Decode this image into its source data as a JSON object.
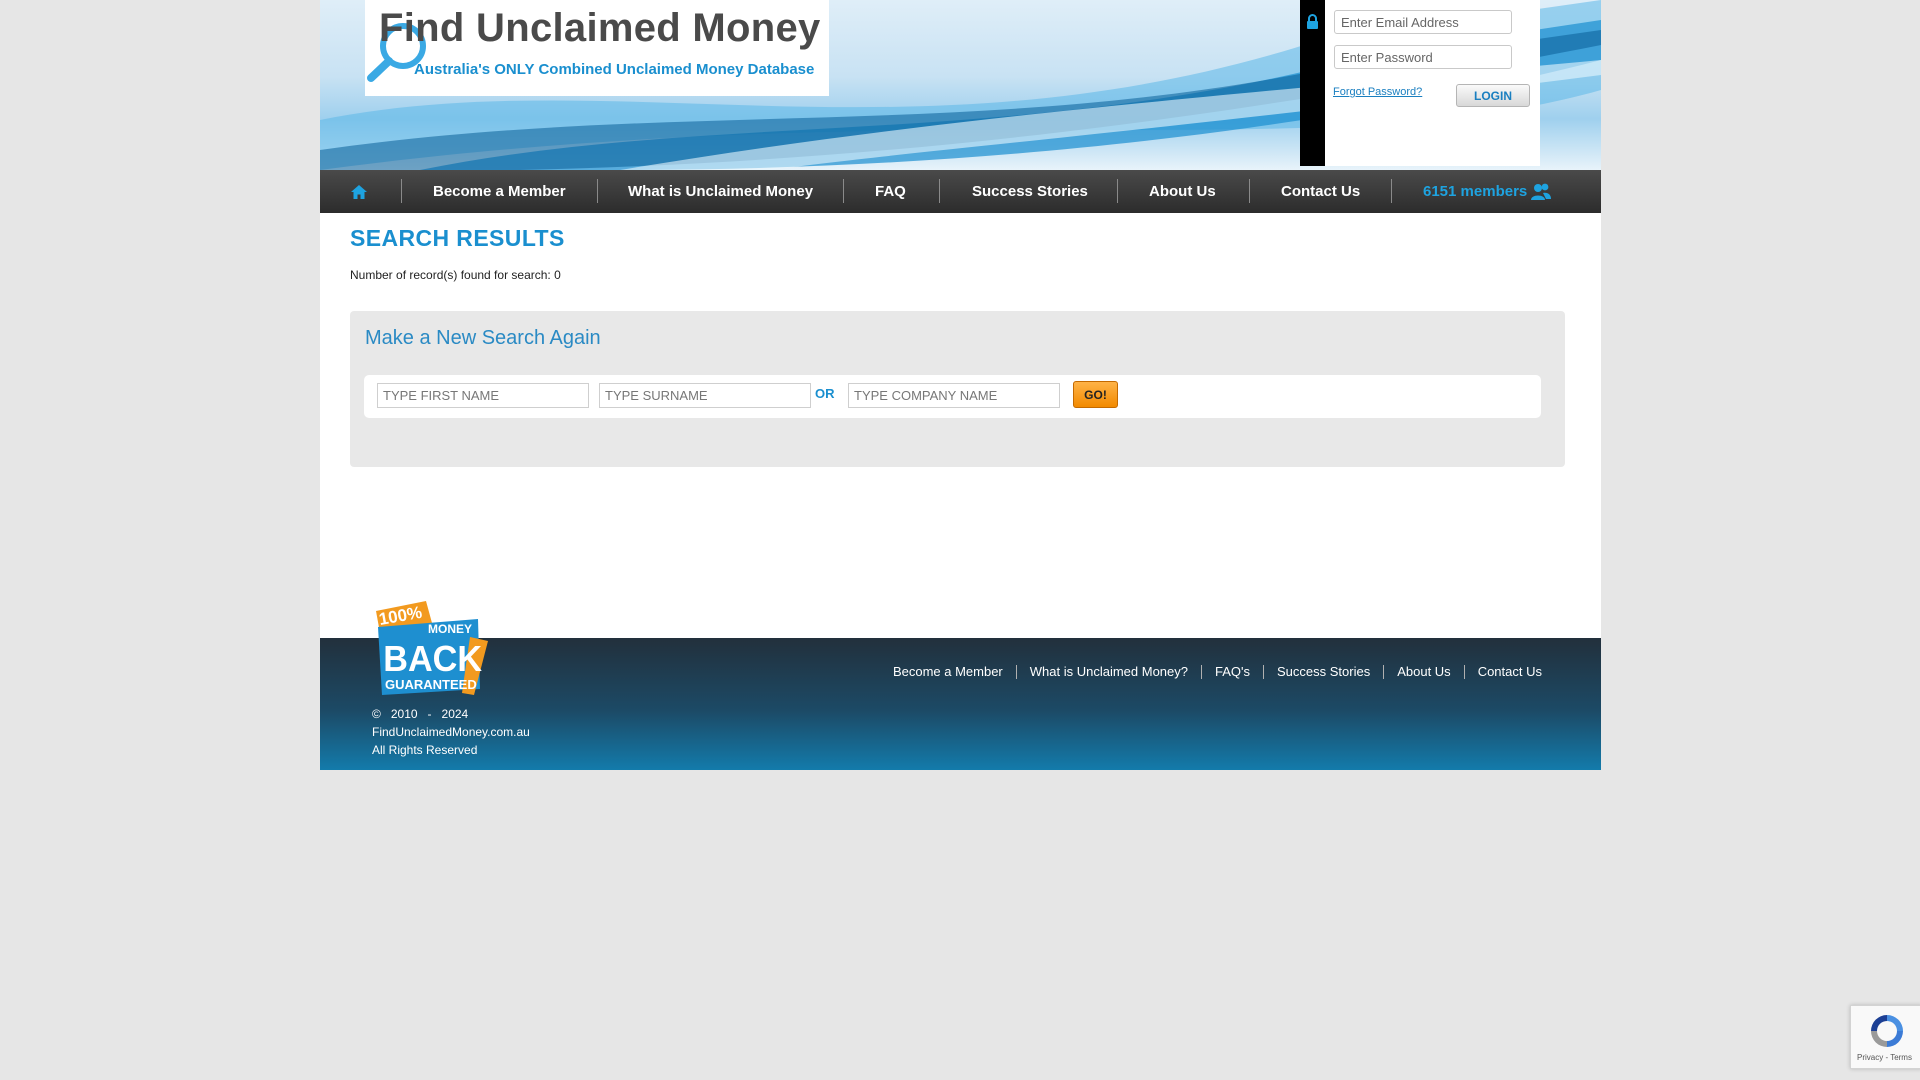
{
  "header": {
    "logo_title": "Find Unclaimed Money",
    "logo_tagline": "Australia's ONLY Combined Unclaimed Money Database"
  },
  "login": {
    "email_placeholder": "Enter Email Address",
    "password_placeholder": "Enter Password",
    "forgot_label": "Forgot Password?",
    "login_label": "LOGIN"
  },
  "nav": {
    "items": [
      {
        "label": "Become a Member"
      },
      {
        "label": "What is Unclaimed Money"
      },
      {
        "label": "FAQ"
      },
      {
        "label": "Success Stories"
      },
      {
        "label": "About Us"
      },
      {
        "label": "Contact Us"
      }
    ],
    "members_count": "6151",
    "members_label": "members"
  },
  "results": {
    "title": "SEARCH RESULTS",
    "records_text": "Number of record(s) found for search: 0"
  },
  "search": {
    "heading": "Make a New Search Again",
    "first_name_placeholder": "TYPE FIRST NAME",
    "surname_placeholder": "TYPE SURNAME",
    "or_label": "OR",
    "company_placeholder": "TYPE COMPANY NAME",
    "go_label": "GO!"
  },
  "footer": {
    "badge": {
      "top": "100%",
      "mid1": "MONEY",
      "mid2": "BACK",
      "bottom": "GUARANTEED"
    },
    "copyright_line1": "©   2010   -   2024",
    "copyright_line2": "FindUnclaimedMoney.com.au",
    "copyright_line3": "All Rights Reserved",
    "links": [
      {
        "label": "Become a Member"
      },
      {
        "label": "What is Unclaimed Money?"
      },
      {
        "label": "FAQ's"
      },
      {
        "label": "Success Stories"
      },
      {
        "label": "About Us"
      },
      {
        "label": "Contact Us"
      }
    ]
  },
  "recaptcha": {
    "text": "Privacy - Terms"
  },
  "colors": {
    "brand_blue": "#1a8fcf",
    "nav_bg": "#333333",
    "go_orange": "#f28a00"
  }
}
